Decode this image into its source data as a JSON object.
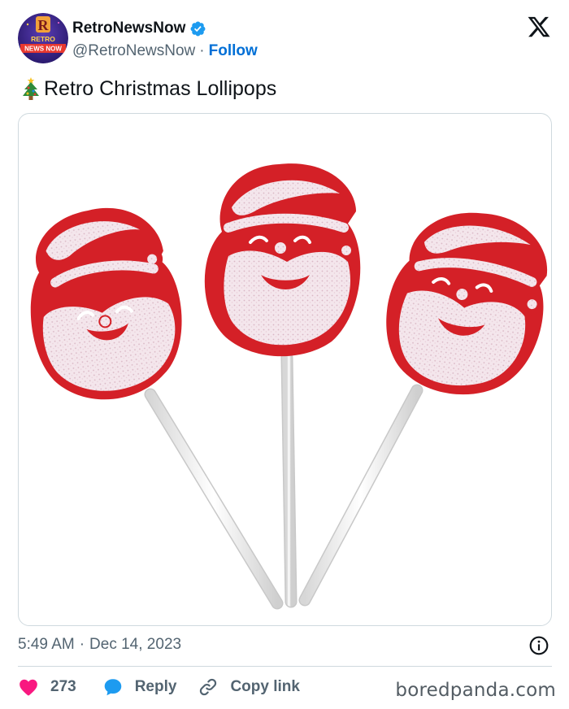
{
  "author": {
    "display_name": "RetroNewsNow",
    "handle": "@RetroNewsNow",
    "separator": "·",
    "follow_label": "Follow",
    "avatar_text_top": "R",
    "avatar_text_line1": "RETRO",
    "avatar_text_line2": "NEWS NOW",
    "verified": true
  },
  "tweet": {
    "emoji_icon": "christmas-tree-icon",
    "text": "Retro Christmas Lollipops"
  },
  "meta": {
    "time": "5:49 AM",
    "separator": "·",
    "date": "Dec 14, 2023"
  },
  "actions": {
    "likes": "273",
    "reply_label": "Reply",
    "copy_link_label": "Copy link"
  },
  "watermark": "boredpanda.com",
  "colors": {
    "like": "#f91880",
    "follow": "#006fd6",
    "verified": "#1d9bf0",
    "reply": "#1d9bf0",
    "muted": "#536471",
    "candy_red": "#d42027"
  }
}
